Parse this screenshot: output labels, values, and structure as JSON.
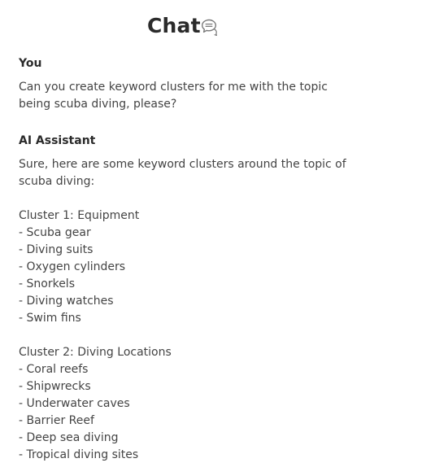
{
  "header": {
    "title": "Chat",
    "icon": "chat-bubbles-icon"
  },
  "messages": [
    {
      "sender": "You",
      "text": "Can you create keyword clusters for me with the topic\nbeing scuba diving, please?"
    },
    {
      "sender": "AI Assistant",
      "intro": "Sure, here are some keyword clusters around the topic of\nscuba diving:",
      "clusters": [
        {
          "heading": "Cluster 1: Equipment",
          "items": [
            "- Scuba gear",
            "- Diving suits",
            "- Oxygen cylinders",
            "- Snorkels",
            "- Diving watches",
            "- Swim fins"
          ]
        },
        {
          "heading": "Cluster 2: Diving Locations",
          "items": [
            "- Coral reefs",
            "- Shipwrecks",
            "- Underwater caves",
            "- Barrier Reef",
            "- Deep sea diving",
            "- Tropical diving sites"
          ]
        }
      ]
    }
  ]
}
